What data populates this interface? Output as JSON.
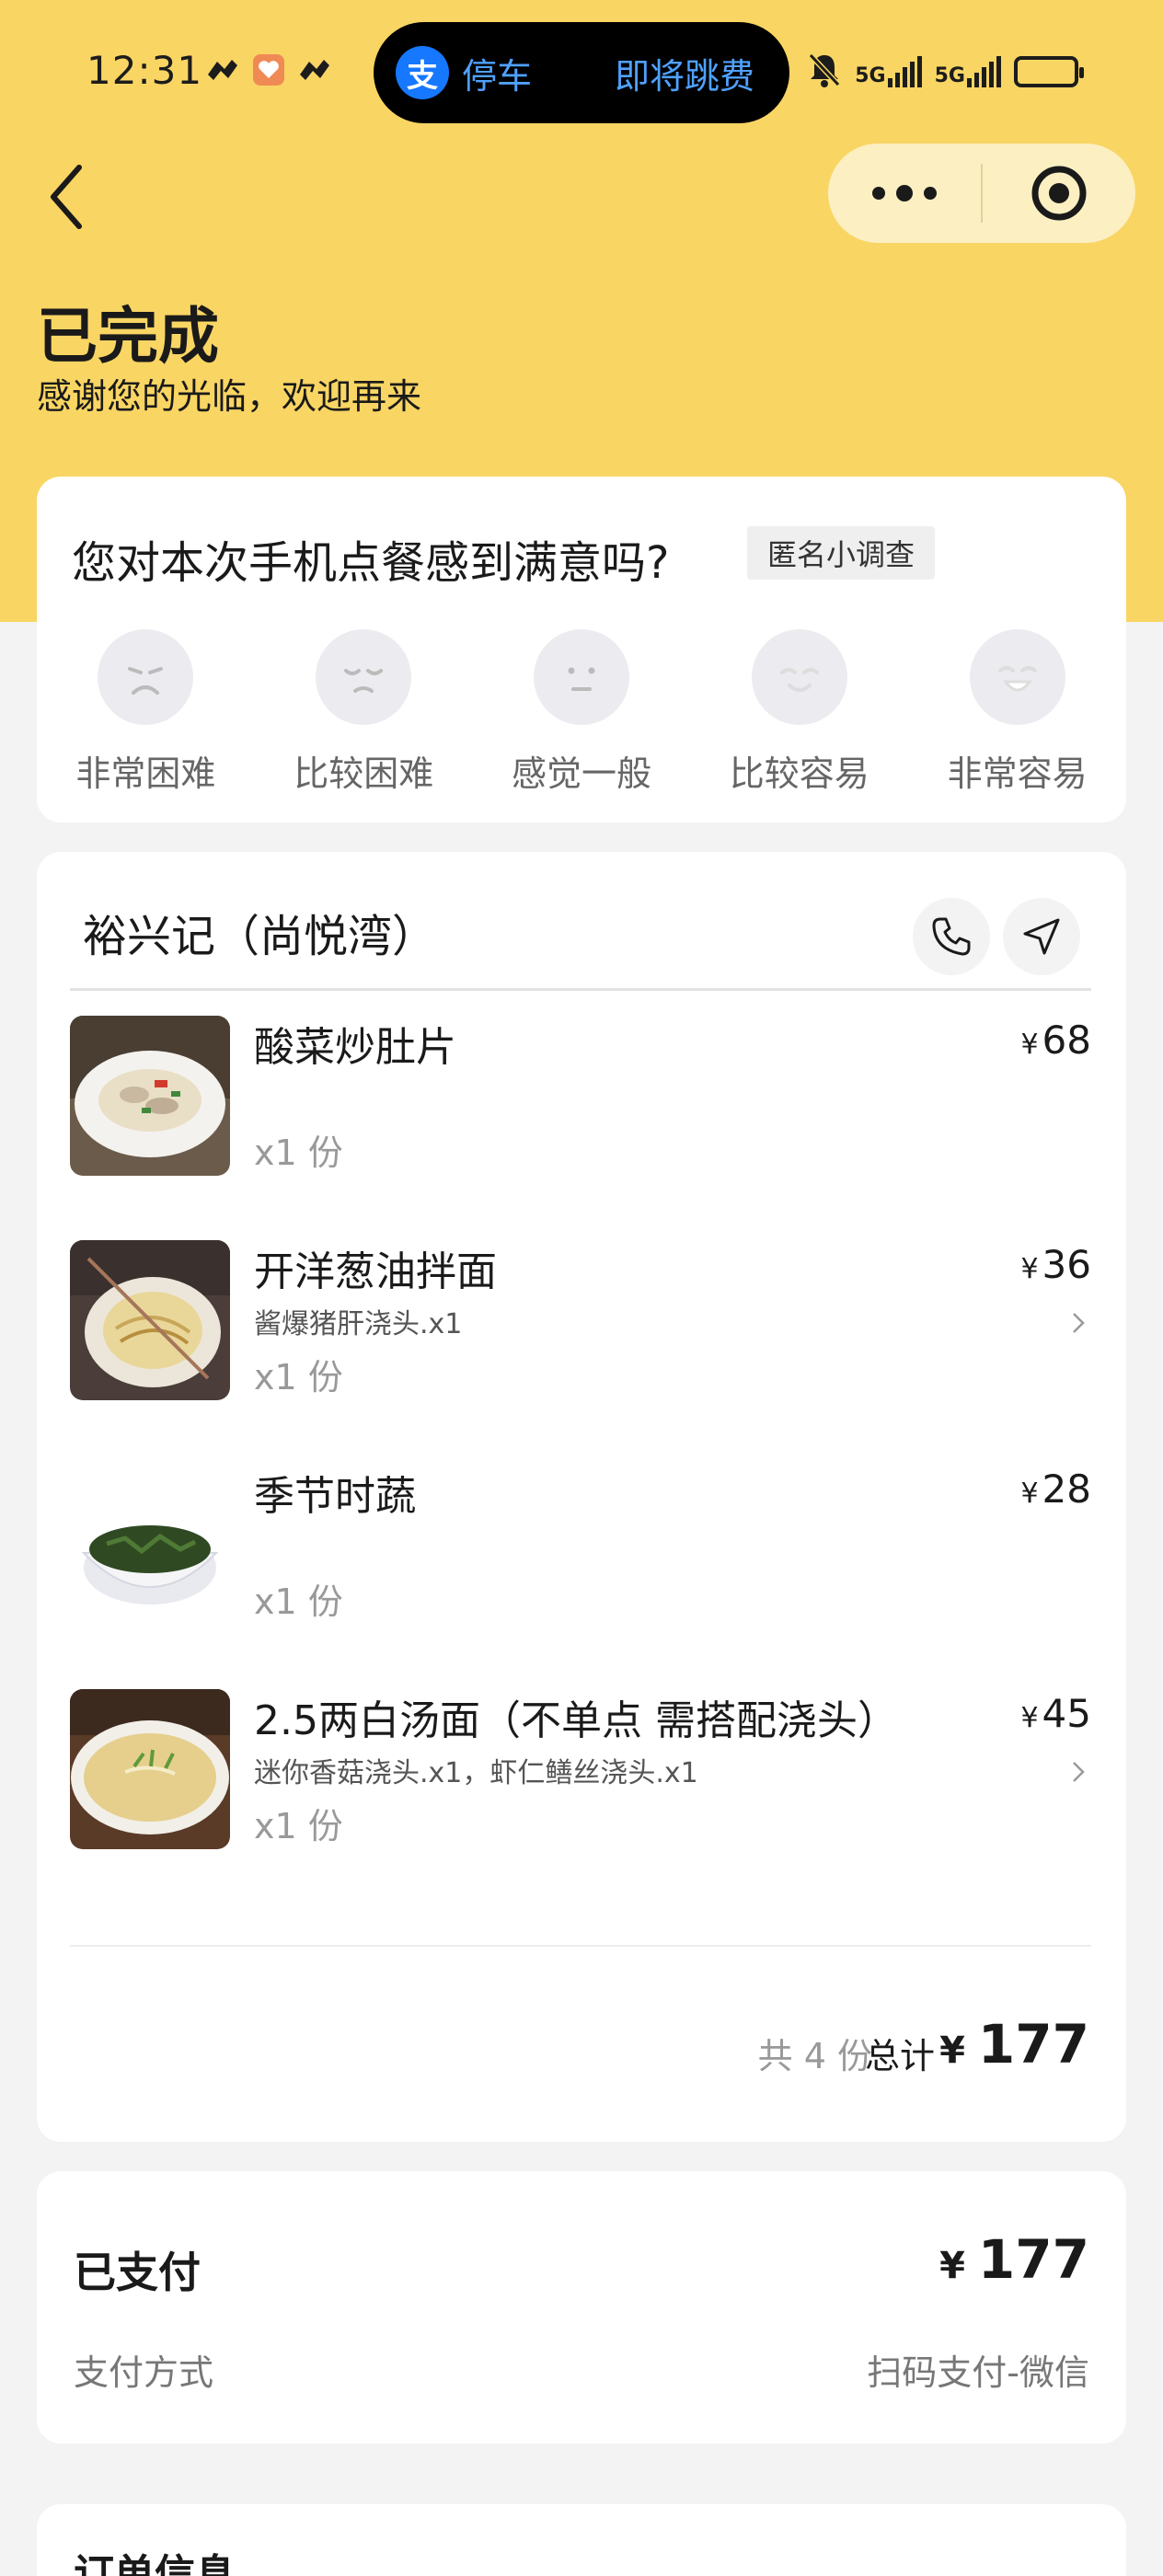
{
  "status_bar": {
    "time": "12:31",
    "pill_text": "停车",
    "pill_action": "即将跳费",
    "pill_logo": "支",
    "signal_label_1": "5G",
    "signal_label_2": "5G"
  },
  "header": {
    "title": "已完成",
    "subtitle": "感谢您的光临，欢迎再来",
    "background_color": "#f9d563"
  },
  "survey": {
    "question": "您对本次手机点餐感到满意吗?",
    "tag": "匿名小调查",
    "options": [
      {
        "label": "非常困难",
        "icon": "face-very-difficult-icon"
      },
      {
        "label": "比较困难",
        "icon": "face-difficult-icon"
      },
      {
        "label": "感觉一般",
        "icon": "face-neutral-icon"
      },
      {
        "label": "比较容易",
        "icon": "face-easy-icon"
      },
      {
        "label": "非常容易",
        "icon": "face-very-easy-icon"
      }
    ]
  },
  "order": {
    "shop_name": "裕兴记（尚悦湾）",
    "currency": "¥",
    "items": [
      {
        "name": "酸菜炒肚片",
        "spec": "",
        "qty": "x1 份",
        "price": "68",
        "has_detail": false
      },
      {
        "name": "开洋葱油拌面",
        "spec": "酱爆猪肝浇头.x1",
        "qty": "x1 份",
        "price": "36",
        "has_detail": true
      },
      {
        "name": "季节时蔬",
        "spec": "",
        "qty": "x1 份",
        "price": "28",
        "has_detail": false
      },
      {
        "name": "2.5两白汤面（不单点 需搭配浇头）",
        "spec": "迷你香菇浇头.x1，虾仁鳝丝浇头.x1",
        "qty": "x1 份",
        "price": "45",
        "has_detail": true
      }
    ],
    "total_count": "共 4 份",
    "total_label": "总计",
    "total_amount": "177"
  },
  "payment": {
    "title": "已支付",
    "amount": "177",
    "method_label": "支付方式",
    "method_value": "扫码支付-微信"
  },
  "order_info": {
    "title": "订单信息"
  }
}
